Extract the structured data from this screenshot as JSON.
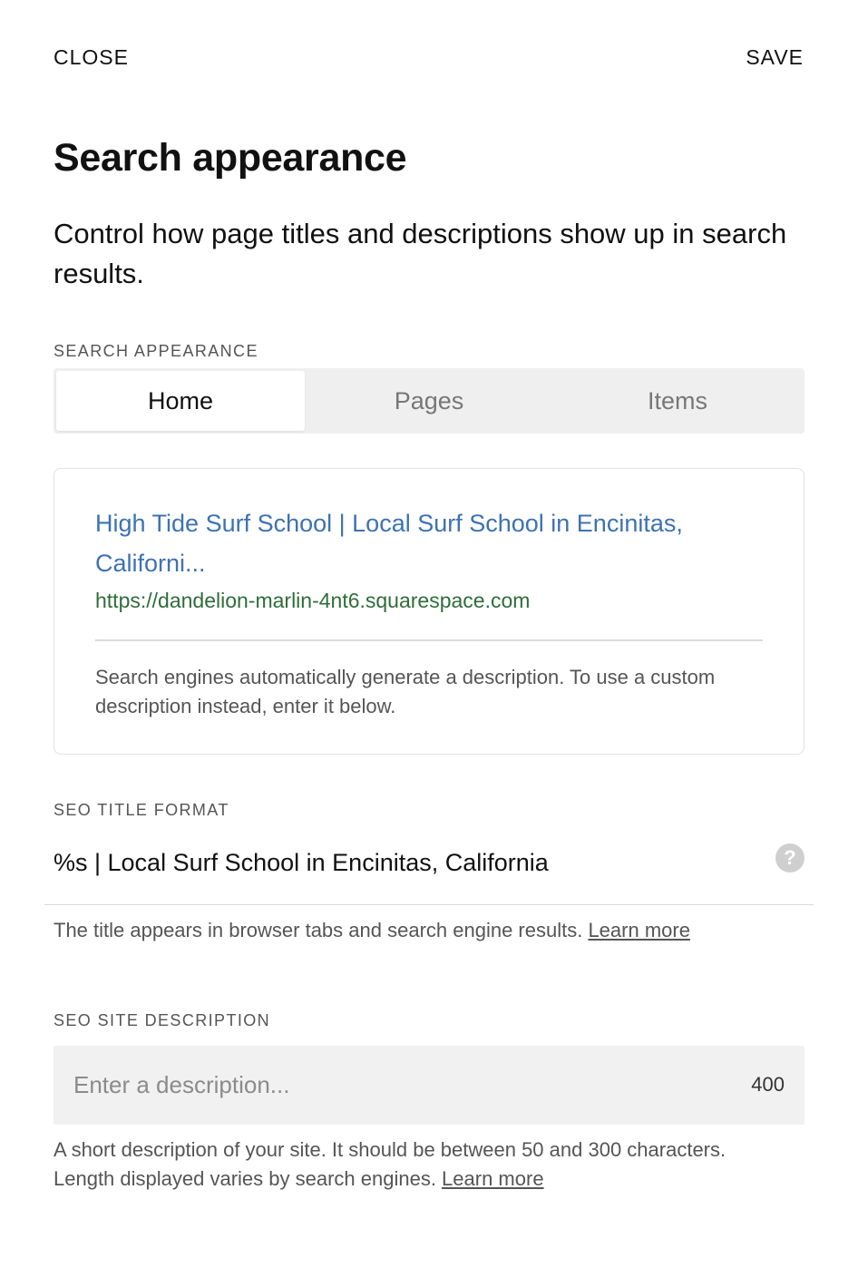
{
  "header": {
    "close_label": "CLOSE",
    "save_label": "SAVE"
  },
  "page": {
    "title": "Search appearance",
    "intro": "Control how page titles and descriptions show up in search results."
  },
  "appearance": {
    "section_label": "SEARCH APPEARANCE",
    "tabs": [
      {
        "label": "Home",
        "active": true
      },
      {
        "label": "Pages",
        "active": false
      },
      {
        "label": "Items",
        "active": false
      }
    ]
  },
  "preview": {
    "title": "High Tide Surf School | Local Surf School in Encinitas, Californi...",
    "url": "https://dandelion-marlin-4nt6.squarespace.com",
    "description": "Search engines automatically generate a description. To use a custom description instead, enter it below."
  },
  "title_format": {
    "section_label": "SEO TITLE FORMAT",
    "value": "%s | Local Surf School in Encinitas, California",
    "help_icon": "question-circle-icon",
    "helper_text": "The title appears in browser tabs and search engine results. ",
    "learn_more": "Learn more"
  },
  "site_description": {
    "section_label": "SEO SITE DESCRIPTION",
    "placeholder": "Enter a description...",
    "char_count": "400",
    "helper_text": "A short description of your site. It should be between 50 and 300 characters. Length displayed varies by search engines. ",
    "learn_more": "Learn more"
  },
  "colors": {
    "preview_title": "#3d72b4",
    "preview_url": "#2f6d3a",
    "tabs_bg": "#efefef",
    "input_bg": "#f1f1f1"
  }
}
